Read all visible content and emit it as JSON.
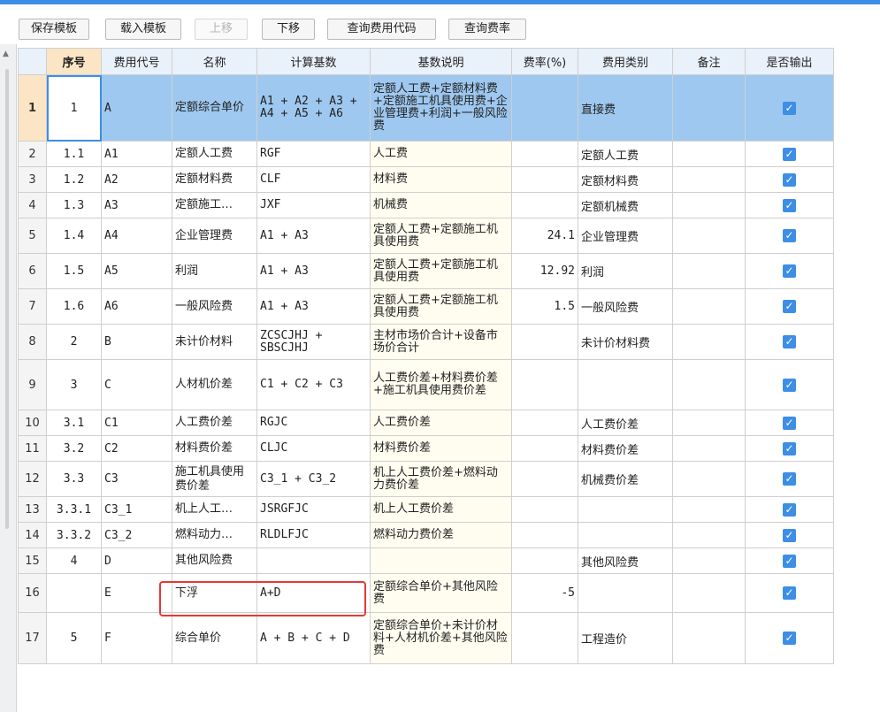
{
  "toolbar": {
    "save_template": "保存模板",
    "load_template": "载入模板",
    "move_up": "上移",
    "move_down": "下移",
    "query_fee_code": "查询费用代码",
    "query_fee_rate": "查询费率"
  },
  "headers": {
    "seq": "序号",
    "code": "费用代号",
    "name": "名称",
    "base": "计算基数",
    "desc": "基数说明",
    "rate": "费率(%)",
    "category": "费用类别",
    "remark": "备注",
    "output": "是否输出"
  },
  "rows": [
    {
      "rn": "1",
      "seq": "1",
      "code": "A",
      "name": "定额综合单价",
      "base": "A1 + A2 + A3 + A4 + A5 + A6",
      "desc": "定额人工费+定额材料费+定额施工机具使用费+企业管理费+利润+一般风险费",
      "rate": "",
      "category": "直接费",
      "remark": "",
      "output": "✓"
    },
    {
      "rn": "2",
      "seq": "1.1",
      "code": "A1",
      "name": "定额人工费",
      "base": "RGF",
      "desc": "人工费",
      "rate": "",
      "category": "定额人工费",
      "remark": "",
      "output": "✓"
    },
    {
      "rn": "3",
      "seq": "1.2",
      "code": "A2",
      "name": "定额材料费",
      "base": "CLF",
      "desc": "材料费",
      "rate": "",
      "category": "定额材料费",
      "remark": "",
      "output": "✓"
    },
    {
      "rn": "4",
      "seq": "1.3",
      "code": "A3",
      "name": "定额施工…",
      "base": "JXF",
      "desc": "机械费",
      "rate": "",
      "category": "定额机械费",
      "remark": "",
      "output": "✓"
    },
    {
      "rn": "5",
      "seq": "1.4",
      "code": "A4",
      "name": "企业管理费",
      "base": "A1 + A3",
      "desc": "定额人工费+定额施工机具使用费",
      "rate": "24.1",
      "category": "企业管理费",
      "remark": "",
      "output": "✓"
    },
    {
      "rn": "6",
      "seq": "1.5",
      "code": "A5",
      "name": "利润",
      "base": "A1 + A3",
      "desc": "定额人工费+定额施工机具使用费",
      "rate": "12.92",
      "category": "利润",
      "remark": "",
      "output": "✓"
    },
    {
      "rn": "7",
      "seq": "1.6",
      "code": "A6",
      "name": "一般风险费",
      "base": "A1 + A3",
      "desc": "定额人工费+定额施工机具使用费",
      "rate": "1.5",
      "category": "一般风险费",
      "remark": "",
      "output": "✓"
    },
    {
      "rn": "8",
      "seq": "2",
      "code": "B",
      "name": "未计价材料",
      "base": "ZCSCJHJ + SBSCJHJ",
      "desc": "主材市场价合计+设备市场价合计",
      "rate": "",
      "category": "未计价材料费",
      "remark": "",
      "output": "✓"
    },
    {
      "rn": "9",
      "seq": "3",
      "code": "C",
      "name": "人材机价差",
      "base": "C1 + C2 + C3",
      "desc": "人工费价差+材料费价差+施工机具使用费价差",
      "rate": "",
      "category": "",
      "remark": "",
      "output": "✓"
    },
    {
      "rn": "10",
      "seq": "3.1",
      "code": "C1",
      "name": "人工费价差",
      "base": "RGJC",
      "desc": "人工费价差",
      "rate": "",
      "category": "人工费价差",
      "remark": "",
      "output": "✓"
    },
    {
      "rn": "11",
      "seq": "3.2",
      "code": "C2",
      "name": "材料费价差",
      "base": "CLJC",
      "desc": "材料费价差",
      "rate": "",
      "category": "材料费价差",
      "remark": "",
      "output": "✓"
    },
    {
      "rn": "12",
      "seq": "3.3",
      "code": "C3",
      "name": "施工机具使用费价差",
      "base": "C3_1 + C3_2",
      "desc": "机上人工费价差+燃料动力费价差",
      "rate": "",
      "category": "机械费价差",
      "remark": "",
      "output": "✓"
    },
    {
      "rn": "13",
      "seq": "3.3.1",
      "code": "C3_1",
      "name": "机上人工…",
      "base": "JSRGFJC",
      "desc": "机上人工费价差",
      "rate": "",
      "category": "",
      "remark": "",
      "output": "✓"
    },
    {
      "rn": "14",
      "seq": "3.3.2",
      "code": "C3_2",
      "name": "燃料动力…",
      "base": "RLDLFJC",
      "desc": "燃料动力费价差",
      "rate": "",
      "category": "",
      "remark": "",
      "output": "✓"
    },
    {
      "rn": "15",
      "seq": "4",
      "code": "D",
      "name": "其他风险费",
      "base": "",
      "desc": "",
      "rate": "",
      "category": "其他风险费",
      "remark": "",
      "output": "✓"
    },
    {
      "rn": "16",
      "seq": "",
      "code": "E",
      "name": "下浮",
      "base": "A+D",
      "desc": "定额综合单价+其他风险费",
      "rate": "-5",
      "category": "",
      "remark": "",
      "output": "✓"
    },
    {
      "rn": "17",
      "seq": "5",
      "code": "F",
      "name": "综合单价",
      "base": "A + B + C + D",
      "desc": "定额综合单价+未计价材料+人材机价差+其他风险费",
      "rate": "",
      "category": "工程造价",
      "remark": "",
      "output": "✓"
    }
  ]
}
